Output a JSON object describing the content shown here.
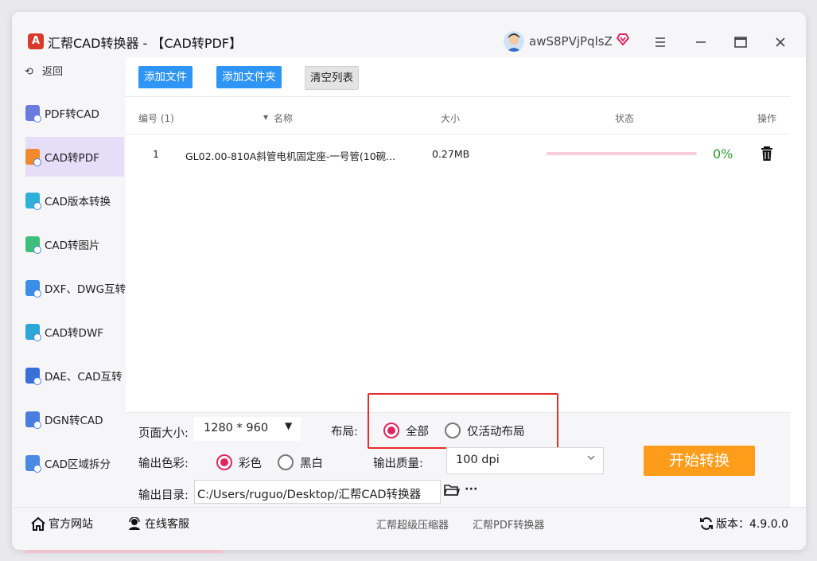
{
  "app": {
    "logo_letter": "A",
    "title": "汇帮CAD转换器 - 【CAD转PDF】",
    "username": "awS8PVjPqlsZ"
  },
  "icons": {
    "vip": "vip-heart-icon",
    "menu": "hamburger-menu-icon",
    "minimize": "minimize-icon",
    "maximize": "maximize-icon",
    "close": "close-icon"
  },
  "sidebar": {
    "back_label": "返回",
    "items": [
      {
        "label": "PDF转CAD"
      },
      {
        "label": "CAD转PDF"
      },
      {
        "label": "CAD版本转换"
      },
      {
        "label": "CAD转图片"
      },
      {
        "label": "DXF、DWG互转"
      },
      {
        "label": "CAD转DWF"
      },
      {
        "label": "DAE、CAD互转"
      },
      {
        "label": "DGN转CAD"
      },
      {
        "label": "CAD区域拆分"
      }
    ]
  },
  "toolbar": {
    "add_file": "添加文件",
    "add_folder": "添加文件夹",
    "clear_list": "清空列表"
  },
  "table": {
    "headers": {
      "index": "编号 (1)",
      "name": "名称",
      "size": "大小",
      "status": "状态",
      "action": "操作"
    },
    "rows": [
      {
        "index": "1",
        "name": "GL02.00-810A斜管电机固定座-一号管(10碗...",
        "size": "0.27MB",
        "progress": 0,
        "percent": "0%"
      }
    ]
  },
  "options": {
    "page_size_label": "页面大小:",
    "page_size_value": "1280 * 960",
    "layout_label": "布局:",
    "layout_all": "全部",
    "layout_active": "仅活动布局",
    "color_label": "输出色彩:",
    "color_color": "彩色",
    "color_bw": "黑白",
    "quality_label": "输出质量:",
    "quality_value": "100 dpi",
    "output_label": "输出目录:",
    "output_path": "C:/Users/ruguo/Desktop/汇帮CAD转换器",
    "more": "···",
    "start_button": "开始转换"
  },
  "footer": {
    "website": "官方网站",
    "support": "在线客服",
    "compressor": "汇帮超级压缩器",
    "pdf_converter": "汇帮PDF转换器",
    "version": "版本：4.9.0.0"
  },
  "colors": {
    "accent_blue": "#2e95f5",
    "start_orange": "#ff9c1a",
    "radio_red": "#e0245e",
    "highlight_red": "#e82b2b",
    "progress_green": "#2d9a2d"
  }
}
